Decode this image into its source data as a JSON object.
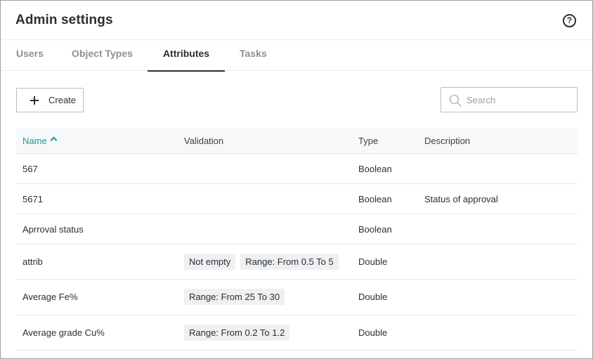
{
  "header": {
    "title": "Admin settings",
    "help_icon": "question-circle-icon"
  },
  "tabs": [
    {
      "label": "Users",
      "active": false
    },
    {
      "label": "Object Types",
      "active": false
    },
    {
      "label": "Attributes",
      "active": true
    },
    {
      "label": "Tasks",
      "active": false
    }
  ],
  "toolbar": {
    "create_label": "Create",
    "create_icon": "plus-icon",
    "search_placeholder": "Search",
    "search_icon": "search-icon"
  },
  "table": {
    "columns": {
      "name": "Name",
      "validation": "Validation",
      "type": "Type",
      "description": "Description"
    },
    "sort": {
      "column": "Name",
      "direction": "ascending"
    },
    "rows": [
      {
        "name": "567",
        "validation": [],
        "type": "Boolean",
        "description": ""
      },
      {
        "name": "5671",
        "validation": [],
        "type": "Boolean",
        "description": "Status of approval"
      },
      {
        "name": "Aprroval status",
        "validation": [],
        "type": "Boolean",
        "description": ""
      },
      {
        "name": "attrib",
        "validation": [
          "Not empty",
          "Range: From 0.5 To 5"
        ],
        "type": "Double",
        "description": ""
      },
      {
        "name": "Average Fe%",
        "validation": [
          "Range: From 25 To 30"
        ],
        "type": "Double",
        "description": ""
      },
      {
        "name": "Average grade Cu%",
        "validation": [
          "Range: From 0.2 To 1.2"
        ],
        "type": "Double",
        "description": ""
      }
    ]
  },
  "colors": {
    "accent": "#1a9c8a",
    "text": "#2b2f33",
    "muted": "#8a9097",
    "tag_bg": "#eef0f2"
  }
}
